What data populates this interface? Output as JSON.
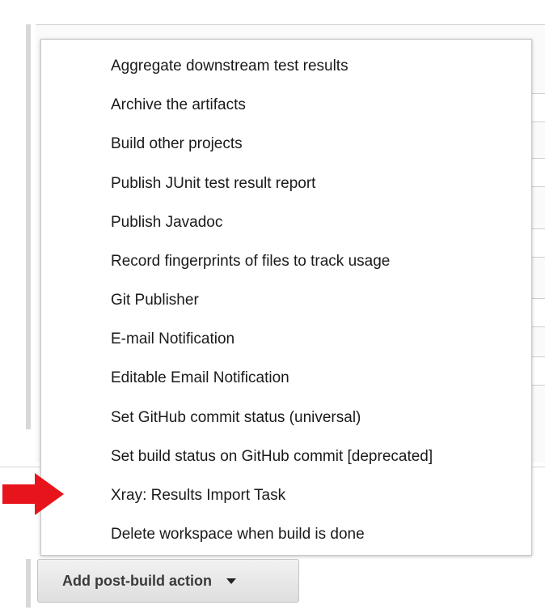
{
  "menu": {
    "items": [
      {
        "label": "Aggregate downstream test results"
      },
      {
        "label": "Archive the artifacts"
      },
      {
        "label": "Build other projects"
      },
      {
        "label": "Publish JUnit test result report"
      },
      {
        "label": "Publish Javadoc"
      },
      {
        "label": "Record fingerprints of files to track usage"
      },
      {
        "label": "Git Publisher"
      },
      {
        "label": "E-mail Notification"
      },
      {
        "label": "Editable Email Notification"
      },
      {
        "label": "Set GitHub commit status (universal)"
      },
      {
        "label": "Set build status on GitHub commit [deprecated]"
      },
      {
        "label": "Xray: Results Import Task"
      },
      {
        "label": "Delete workspace when build is done"
      }
    ],
    "highlighted_item": "Xray: Results Import Task"
  },
  "annotation": {
    "icon": "red-arrow-icon",
    "color": "#e8141b"
  },
  "add_action_button": {
    "label": "Add post-build action",
    "icon": "caret-down-icon"
  }
}
